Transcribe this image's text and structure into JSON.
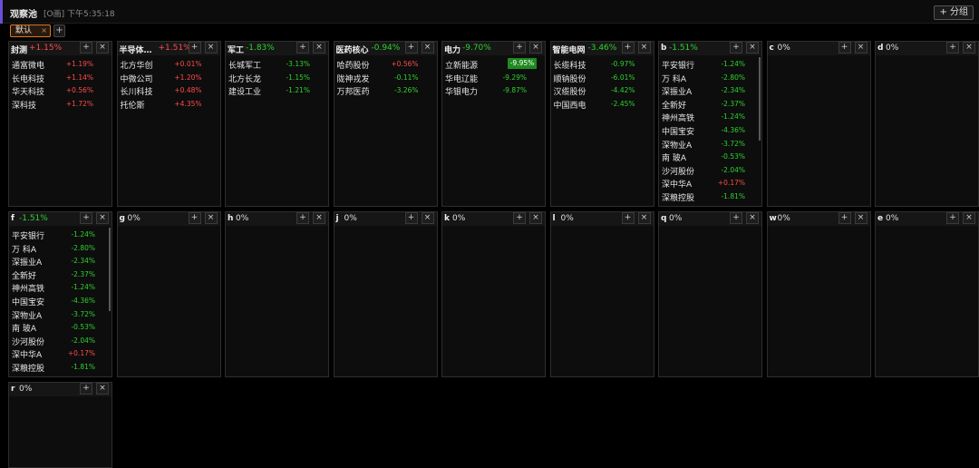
{
  "app": {
    "title": "观察池",
    "meta": "[O画] 下午5:35:18",
    "group_button": "+ 分组"
  },
  "tabs": {
    "active": "默认",
    "close": "×",
    "add": "+"
  },
  "buttons": {
    "add": "+",
    "close": "×"
  },
  "colors": {
    "up": "#ff4b4b",
    "down": "#2fd12f",
    "highlight": "#1f8a1f",
    "active_tab_border": "#d97a2a",
    "accent": "#6b4fd8"
  },
  "panels": [
    {
      "name": "封测",
      "pct": "+1.15%",
      "dir": "up",
      "rows": [
        {
          "name": "通富微电",
          "val": "+1.19%",
          "dir": "up"
        },
        {
          "name": "长电科技",
          "val": "+1.14%",
          "dir": "up"
        },
        {
          "name": "华天科技",
          "val": "+0.56%",
          "dir": "up"
        },
        {
          "name": "深科技",
          "val": "+1.72%",
          "dir": "up"
        }
      ]
    },
    {
      "name": "半导体…",
      "pct": "+1.51%",
      "dir": "up",
      "rows": [
        {
          "name": "北方华创",
          "val": "+0.01%",
          "dir": "up"
        },
        {
          "name": "中微公司",
          "val": "+1.20%",
          "dir": "up"
        },
        {
          "name": "长川科技",
          "val": "+0.48%",
          "dir": "up"
        },
        {
          "name": "托伦斯",
          "val": "+4.35%",
          "dir": "up"
        }
      ]
    },
    {
      "name": "军工",
      "pct": "-1.83%",
      "dir": "down",
      "rows": [
        {
          "name": "长城军工",
          "val": "-3.13%",
          "dir": "down"
        },
        {
          "name": "北方长龙",
          "val": "-1.15%",
          "dir": "down"
        },
        {
          "name": "建设工业",
          "val": "-1.21%",
          "dir": "down"
        }
      ]
    },
    {
      "name": "医药核心",
      "pct": "-0.94%",
      "dir": "down",
      "rows": [
        {
          "name": "哈药股份",
          "val": "+0.56%",
          "dir": "up"
        },
        {
          "name": "陇神戎发",
          "val": "-0.11%",
          "dir": "down"
        },
        {
          "name": "万邦医药",
          "val": "-3.26%",
          "dir": "down"
        }
      ]
    },
    {
      "name": "电力",
      "pct": "-9.70%",
      "dir": "down",
      "rows": [
        {
          "name": "立新能源",
          "val": "-9.95%",
          "dir": "down",
          "hl": true
        },
        {
          "name": "华电辽能",
          "val": "-9.29%",
          "dir": "down"
        },
        {
          "name": "华银电力",
          "val": "-9.87%",
          "dir": "down"
        }
      ]
    },
    {
      "name": "智能电网",
      "pct": "-3.46%",
      "dir": "down",
      "rows": [
        {
          "name": "长缆科技",
          "val": "-0.97%",
          "dir": "down"
        },
        {
          "name": "顺钠股份",
          "val": "-6.01%",
          "dir": "down"
        },
        {
          "name": "汉缆股份",
          "val": "-4.42%",
          "dir": "down"
        },
        {
          "name": "中国西电",
          "val": "-2.45%",
          "dir": "down"
        }
      ]
    },
    {
      "name": "b",
      "pct": "-1.51%",
      "dir": "down",
      "scroll": true,
      "rows": [
        {
          "name": "平安银行",
          "val": "-1.24%",
          "dir": "down"
        },
        {
          "name": "万 科A",
          "val": "-2.80%",
          "dir": "down"
        },
        {
          "name": "深振业A",
          "val": "-2.34%",
          "dir": "down"
        },
        {
          "name": "全新好",
          "val": "-2.37%",
          "dir": "down"
        },
        {
          "name": "神州高铁",
          "val": "-1.24%",
          "dir": "down"
        },
        {
          "name": "中国宝安",
          "val": "-4.36%",
          "dir": "down"
        },
        {
          "name": "深物业A",
          "val": "-3.72%",
          "dir": "down"
        },
        {
          "name": "南 玻A",
          "val": "-0.53%",
          "dir": "down"
        },
        {
          "name": "沙河股份",
          "val": "-2.04%",
          "dir": "down"
        },
        {
          "name": "深中华A",
          "val": "+0.17%",
          "dir": "up"
        },
        {
          "name": "深粮控股",
          "val": "-1.81%",
          "dir": "down"
        }
      ]
    },
    {
      "name": "c",
      "pct": "0%",
      "dir": "flat",
      "rows": []
    },
    {
      "name": "d",
      "pct": "0%",
      "dir": "flat",
      "rows": []
    },
    {
      "name": "f",
      "pct": "-1.51%",
      "dir": "down",
      "scroll": true,
      "rows": [
        {
          "name": "平安银行",
          "val": "-1.24%",
          "dir": "down"
        },
        {
          "name": "万 科A",
          "val": "-2.80%",
          "dir": "down"
        },
        {
          "name": "深振业A",
          "val": "-2.34%",
          "dir": "down"
        },
        {
          "name": "全新好",
          "val": "-2.37%",
          "dir": "down"
        },
        {
          "name": "神州高铁",
          "val": "-1.24%",
          "dir": "down"
        },
        {
          "name": "中国宝安",
          "val": "-4.36%",
          "dir": "down"
        },
        {
          "name": "深物业A",
          "val": "-3.72%",
          "dir": "down"
        },
        {
          "name": "南 玻A",
          "val": "-0.53%",
          "dir": "down"
        },
        {
          "name": "沙河股份",
          "val": "-2.04%",
          "dir": "down"
        },
        {
          "name": "深中华A",
          "val": "+0.17%",
          "dir": "up"
        },
        {
          "name": "深粮控股",
          "val": "-1.81%",
          "dir": "down"
        }
      ]
    },
    {
      "name": "g",
      "pct": "0%",
      "dir": "flat",
      "rows": []
    },
    {
      "name": "h",
      "pct": "0%",
      "dir": "flat",
      "rows": []
    },
    {
      "name": "j",
      "pct": "0%",
      "dir": "flat",
      "rows": []
    },
    {
      "name": "k",
      "pct": "0%",
      "dir": "flat",
      "rows": []
    },
    {
      "name": "l",
      "pct": "0%",
      "dir": "flat",
      "rows": []
    },
    {
      "name": "q",
      "pct": "0%",
      "dir": "flat",
      "rows": []
    },
    {
      "name": "w",
      "pct": "0%",
      "dir": "flat",
      "rows": []
    },
    {
      "name": "e",
      "pct": "0%",
      "dir": "flat",
      "rows": []
    },
    {
      "name": "r",
      "pct": "0%",
      "dir": "flat",
      "rows": []
    }
  ]
}
